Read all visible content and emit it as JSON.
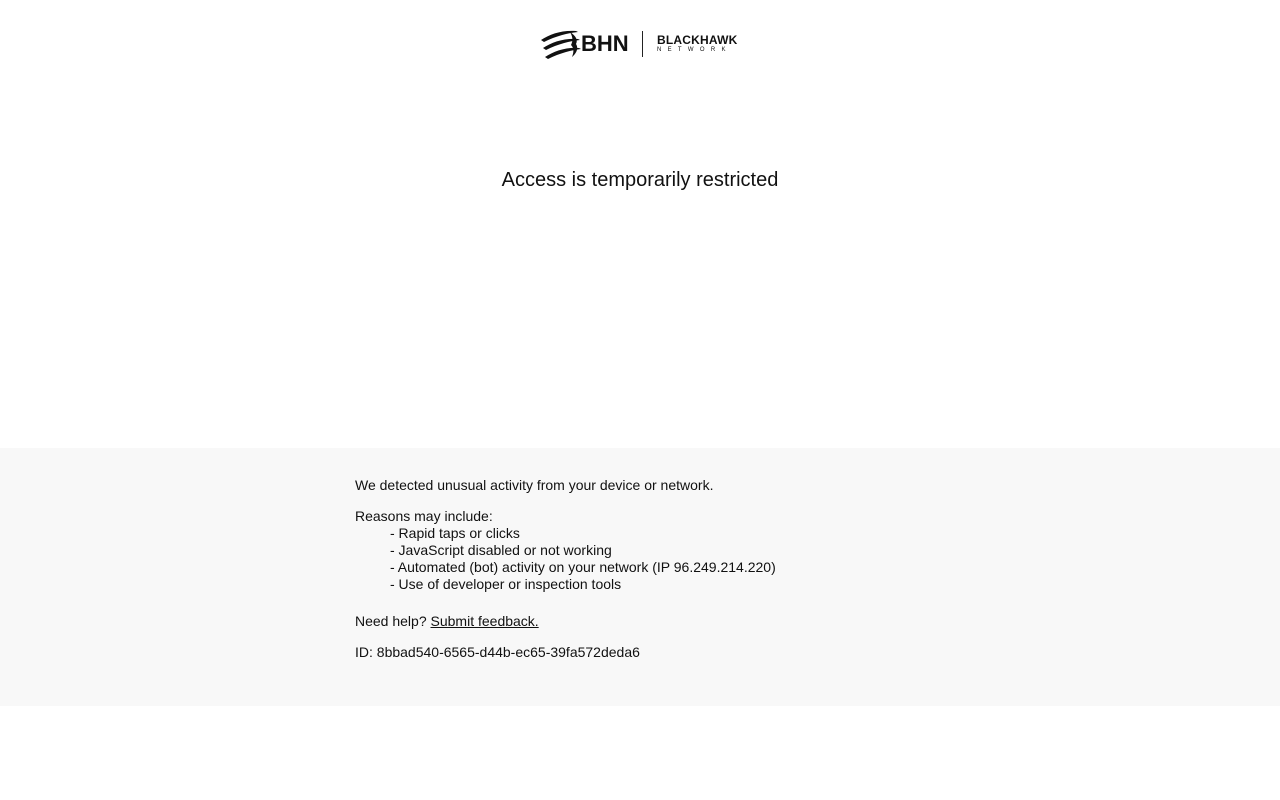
{
  "header": {
    "logo": {
      "mark_icon": "bhn-swoosh-icon",
      "bhn_text": "BHN",
      "brand_text": "BLACKHAWK",
      "brand_subtext": "NETWORK"
    }
  },
  "main": {
    "title": "Access is temporarily restricted"
  },
  "info": {
    "detected_text": "We detected unusual activity from your device or network.",
    "reasons_heading": "Reasons may include:",
    "reasons": [
      "- Rapid taps or clicks",
      "- JavaScript disabled or not working",
      "- Automated (bot) activity on your network (IP 96.249.214.220)",
      "- Use of developer or inspection tools"
    ],
    "help_prefix": "Need help? ",
    "help_link_label": "Submit feedback.",
    "id_text": "ID: 8bbad540-6565-d44b-ec65-39fa572deda6"
  },
  "colors": {
    "text": "#111111",
    "panel_background": "#f8f8f8",
    "page_background": "#ffffff"
  }
}
